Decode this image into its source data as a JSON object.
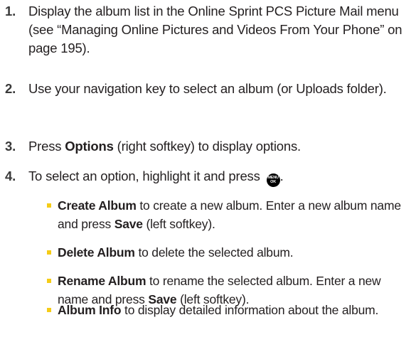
{
  "steps": [
    {
      "number": "1.",
      "text": "Display the album list in the Online Sprint PCS Picture Mail menu (see “Managing Online Pictures and Videos From Your Phone” on page 195)."
    },
    {
      "number": "2.",
      "text": "Use your navigation key to select an album (or Uploads folder)."
    },
    {
      "number": "3.",
      "pre": "Press ",
      "bold": "Options",
      "post": " (right softkey) to display options."
    },
    {
      "number": "4.",
      "pre": "To select an option, highlight it and press ",
      "key_top": "MENU",
      "key_bottom": "OK",
      "post": "."
    }
  ],
  "bullets": [
    {
      "bold": "Create Album",
      "text": " to create a new album. Enter a new album name and press ",
      "bold2": "Save",
      "text2": " (left softkey)."
    },
    {
      "bold": "Delete Album",
      "text": " to delete the selected album."
    },
    {
      "bold": "Rename Album",
      "text": " to rename the selected album. Enter a new name and press ",
      "bold2": "Save",
      "text2": " (left softkey)."
    },
    {
      "bold": "Album Info",
      "text": " to display detailed information about the album."
    }
  ],
  "colors": {
    "bullet": "#f5cc17",
    "text": "#231f20",
    "key": "#000000"
  },
  "icons": {
    "menu_ok_key": "menu-ok-key-icon",
    "bullet": "square-bullet-icon"
  }
}
